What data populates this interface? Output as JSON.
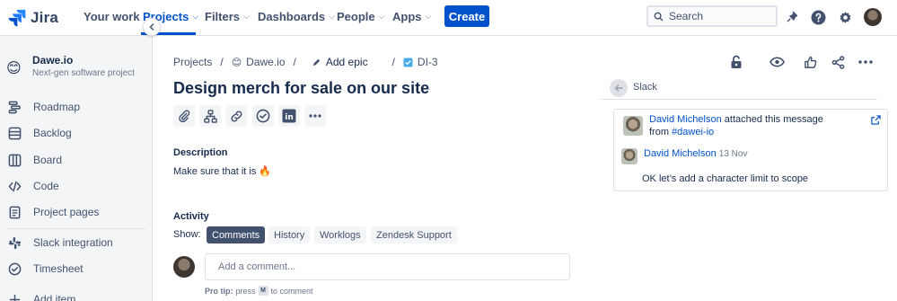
{
  "topnav": {
    "brand": "Jira",
    "items": [
      {
        "label": "Your work",
        "chevron": false,
        "active": false
      },
      {
        "label": "Projects",
        "chevron": true,
        "active": true
      },
      {
        "label": "Filters",
        "chevron": true,
        "active": false
      },
      {
        "label": "Dashboards",
        "chevron": true,
        "active": false
      },
      {
        "label": "People",
        "chevron": true,
        "active": false
      },
      {
        "label": "Apps",
        "chevron": true,
        "active": false
      }
    ],
    "create_label": "Create",
    "search_placeholder": "Search",
    "accent": "#0052CC"
  },
  "sidebar": {
    "project_emoji": "😊",
    "project_name": "Dawe.io",
    "project_type": "Next-gen software project",
    "items": [
      {
        "label": "Roadmap",
        "icon": "roadmap-icon"
      },
      {
        "label": "Backlog",
        "icon": "backlog-icon"
      },
      {
        "label": "Board",
        "icon": "board-icon"
      },
      {
        "label": "Code",
        "icon": "code-icon"
      },
      {
        "label": "Project pages",
        "icon": "pages-icon"
      },
      {
        "label": "Slack integration",
        "icon": "slack-icon"
      },
      {
        "label": "Timesheet",
        "icon": "timesheet-icon"
      },
      {
        "label": "Add item",
        "icon": "add-icon"
      }
    ]
  },
  "breadcrumb": {
    "projects": "Projects",
    "project": "Dawe.io",
    "epic": "Add epic",
    "issue_key": "DI-3",
    "sep": "/"
  },
  "issue": {
    "title": "Design merch for sale on our site",
    "description_label": "Description",
    "description_text": "Make sure that it is",
    "description_emoji": "🔥"
  },
  "activity": {
    "label": "Activity",
    "show_label": "Show:",
    "tabs": [
      "Comments",
      "History",
      "Worklogs",
      "Zendesk Support"
    ],
    "selected_tab": "Comments",
    "comment_placeholder": "Add a comment...",
    "protip_prefix": "Pro tip:",
    "protip_press": "press",
    "protip_key": "M",
    "protip_suffix": "to comment"
  },
  "slack": {
    "title": "Slack",
    "author": "David Michelson",
    "attached_text": "attached this message",
    "from_text": "from",
    "channel": "#dawei-io",
    "date": "13 Nov",
    "message": "OK let’s add a character limit to scope"
  }
}
